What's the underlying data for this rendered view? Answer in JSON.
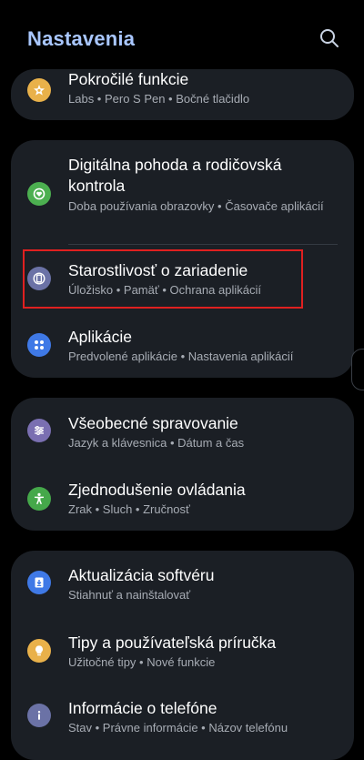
{
  "header": {
    "title": "Nastavenia"
  },
  "cards": [
    {
      "items": [
        {
          "name": "Pokročilé funkcie",
          "sub": "Labs  •  Pero S Pen  •  Bočné tlačidlo",
          "icon": "star-plus-icon",
          "color": "#e9b14a"
        }
      ]
    },
    {
      "items": [
        {
          "name": "Digitálna pohoda a rodičovská kontrola",
          "sub": "Doba používania obrazovky  •  Časovače aplikácií",
          "icon": "heart-circle-icon",
          "color": "#4caf50"
        },
        {
          "name": "Starostlivosť o zariadenie",
          "sub": "Úložisko  •  Pamäť  •  Ochrana aplikácií",
          "icon": "device-care-icon",
          "color": "#6b72a6"
        },
        {
          "name": "Aplikácie",
          "sub": "Predvolené aplikácie  •  Nastavenia aplikácií",
          "icon": "apps-grid-icon",
          "color": "#3f79e6"
        }
      ]
    },
    {
      "items": [
        {
          "name": "Všeobecné spravovanie",
          "sub": "Jazyk a klávesnica  •  Dátum a čas",
          "icon": "sliders-icon",
          "color": "#7a6fb1"
        },
        {
          "name": "Zjednodušenie ovládania",
          "sub": "Zrak  •  Sluch  •  Zručnosť",
          "icon": "accessibility-icon",
          "color": "#45a84a"
        }
      ]
    },
    {
      "items": [
        {
          "name": "Aktualizácia softvéru",
          "sub": "Stiahnuť a nainštalovať",
          "icon": "download-icon",
          "color": "#3f79e6"
        },
        {
          "name": "Tipy a používateľská príručka",
          "sub": "Užitočné tipy  •  Nové funkcie",
          "icon": "lightbulb-icon",
          "color": "#e9b14a"
        },
        {
          "name": "Informácie o telefóne",
          "sub": "Stav  •  Právne informácie  •  Názov telefónu",
          "icon": "info-icon",
          "color": "#6b72a6"
        }
      ]
    }
  ]
}
